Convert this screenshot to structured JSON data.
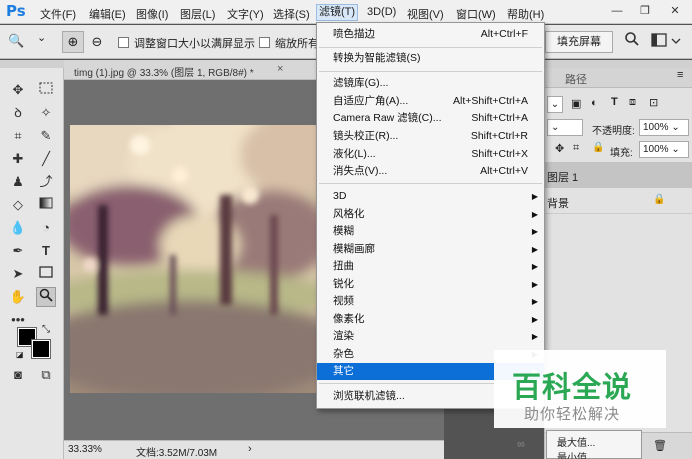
{
  "app": {
    "logo": "Ps"
  },
  "menubar": {
    "items": [
      "文件(F)",
      "编辑(E)",
      "图像(I)",
      "图层(L)",
      "文字(Y)",
      "选择(S)",
      "滤镜(T)",
      "3D(D)",
      "视图(V)",
      "窗口(W)",
      "帮助(H)"
    ],
    "window_controls": [
      "—",
      "❐",
      "✕"
    ]
  },
  "options": {
    "zoom_icon": "🔍",
    "zoom_dropdown": "⌄",
    "zoom_in": "⊕",
    "zoom_out": "⊖",
    "resize_windows_label": "调整窗口大小以满屏显示",
    "zoom_all_label": "缩放所有",
    "fill_screen_button": "填充屏幕"
  },
  "document": {
    "tab_title": "timg (1).jpg @ 33.3% (图层 1, RGB/8#) *",
    "tab_close": "×",
    "status_zoom": "33.33%",
    "status_doc": "文档:3.52M/7.03M",
    "status_arrow": "›"
  },
  "filter_menu": {
    "top_items": [
      {
        "label": "喷色描边",
        "shortcut": "Alt+Ctrl+F"
      },
      {
        "label": "转换为智能滤镜(S)",
        "shortcut": ""
      }
    ],
    "mid_items": [
      {
        "label": "滤镜库(G)...",
        "shortcut": ""
      },
      {
        "label": "自适应广角(A)...",
        "shortcut": "Alt+Shift+Ctrl+A"
      },
      {
        "label": "Camera Raw 滤镜(C)...",
        "shortcut": "Shift+Ctrl+A"
      },
      {
        "label": "镜头校正(R)...",
        "shortcut": "Shift+Ctrl+R"
      },
      {
        "label": "液化(L)...",
        "shortcut": "Shift+Ctrl+X"
      },
      {
        "label": "消失点(V)...",
        "shortcut": "Alt+Ctrl+V"
      }
    ],
    "sub_items": [
      "3D",
      "风格化",
      "模糊",
      "模糊画廊",
      "扭曲",
      "锐化",
      "视频",
      "像素化",
      "渲染",
      "杂色",
      "其它"
    ],
    "highlighted": "其它",
    "bottom_item": "浏览联机滤镜..."
  },
  "right_panel": {
    "tab_paths": "路径",
    "opacity_label": "不透明度:",
    "opacity_value": "100%",
    "fill_label": "填充:",
    "fill_value": "100%",
    "layer1_name": "图层 1",
    "background_name": "背景",
    "lock_icon": "🔒",
    "link_icon": "∞"
  },
  "submenu_peek": {
    "item1": "最大值...",
    "item2": "最小值..."
  },
  "watermark": {
    "title": "百科全说",
    "subtitle": "助你轻松解决"
  },
  "colors": {
    "accent": "#0c6fd8",
    "watermark_title": "#2aa854",
    "logo": "#1e7ee0"
  }
}
